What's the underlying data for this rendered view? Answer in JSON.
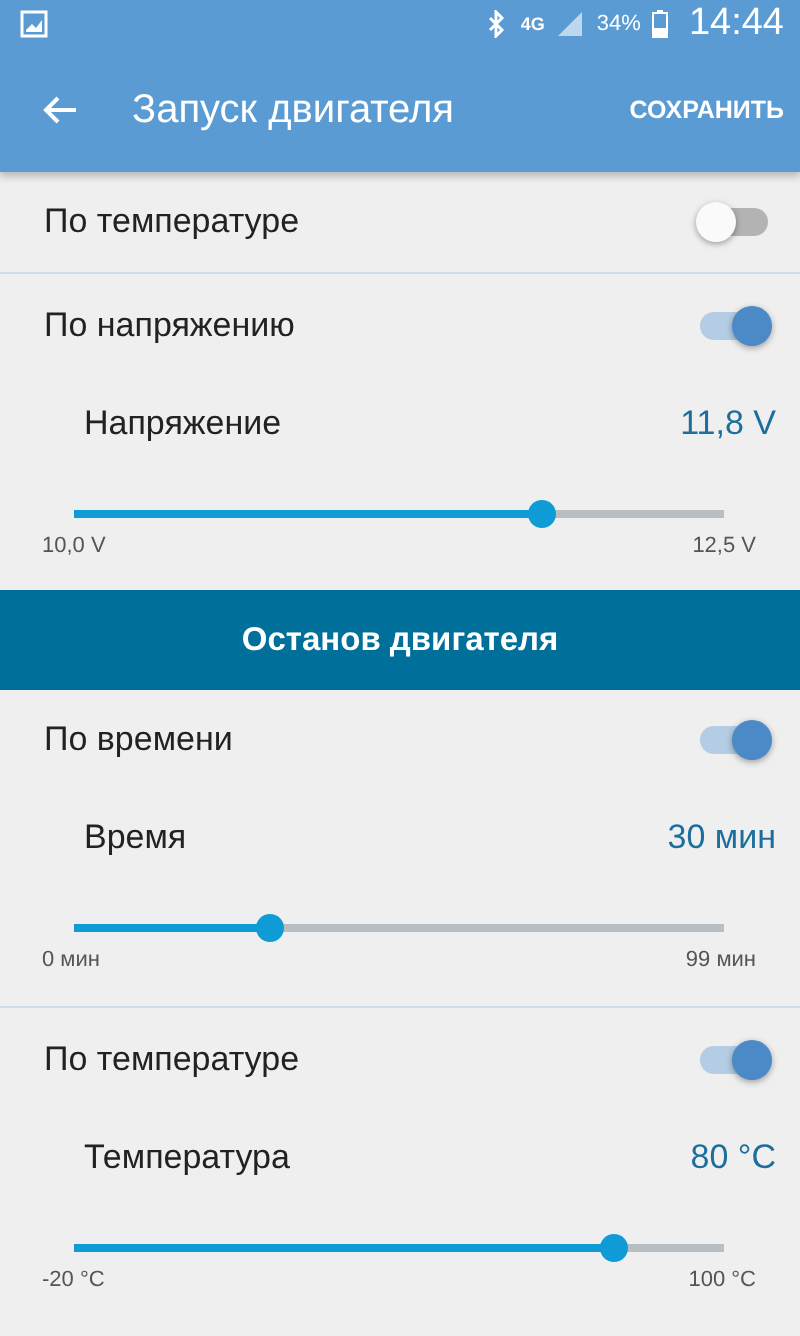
{
  "status_bar": {
    "network": "4G",
    "battery": "34%",
    "time": "14:44"
  },
  "app_bar": {
    "title": "Запуск двигателя",
    "action": "СОХРАНИТЬ"
  },
  "groups": [
    {
      "items": [
        {
          "label": "По температуре",
          "on": false
        },
        {
          "label": "По напряжению",
          "on": true,
          "setting": {
            "label": "Напряжение",
            "value": "11,8 V",
            "level": 0.72,
            "min": "10,0 V",
            "max": "12,5 V"
          }
        }
      ]
    },
    {
      "header": "Останов двигателя",
      "items": [
        {
          "label": "По времени",
          "on": true,
          "setting": {
            "label": "Время",
            "value": "30 мин",
            "level": 0.3,
            "min": "0 мин",
            "max": "99 мин"
          }
        },
        {
          "label": "По температуре",
          "on": true,
          "setting": {
            "label": "Температура",
            "value": "80 °C",
            "level": 0.83,
            "min": "-20 °C",
            "max": "100 °C"
          }
        }
      ]
    }
  ]
}
